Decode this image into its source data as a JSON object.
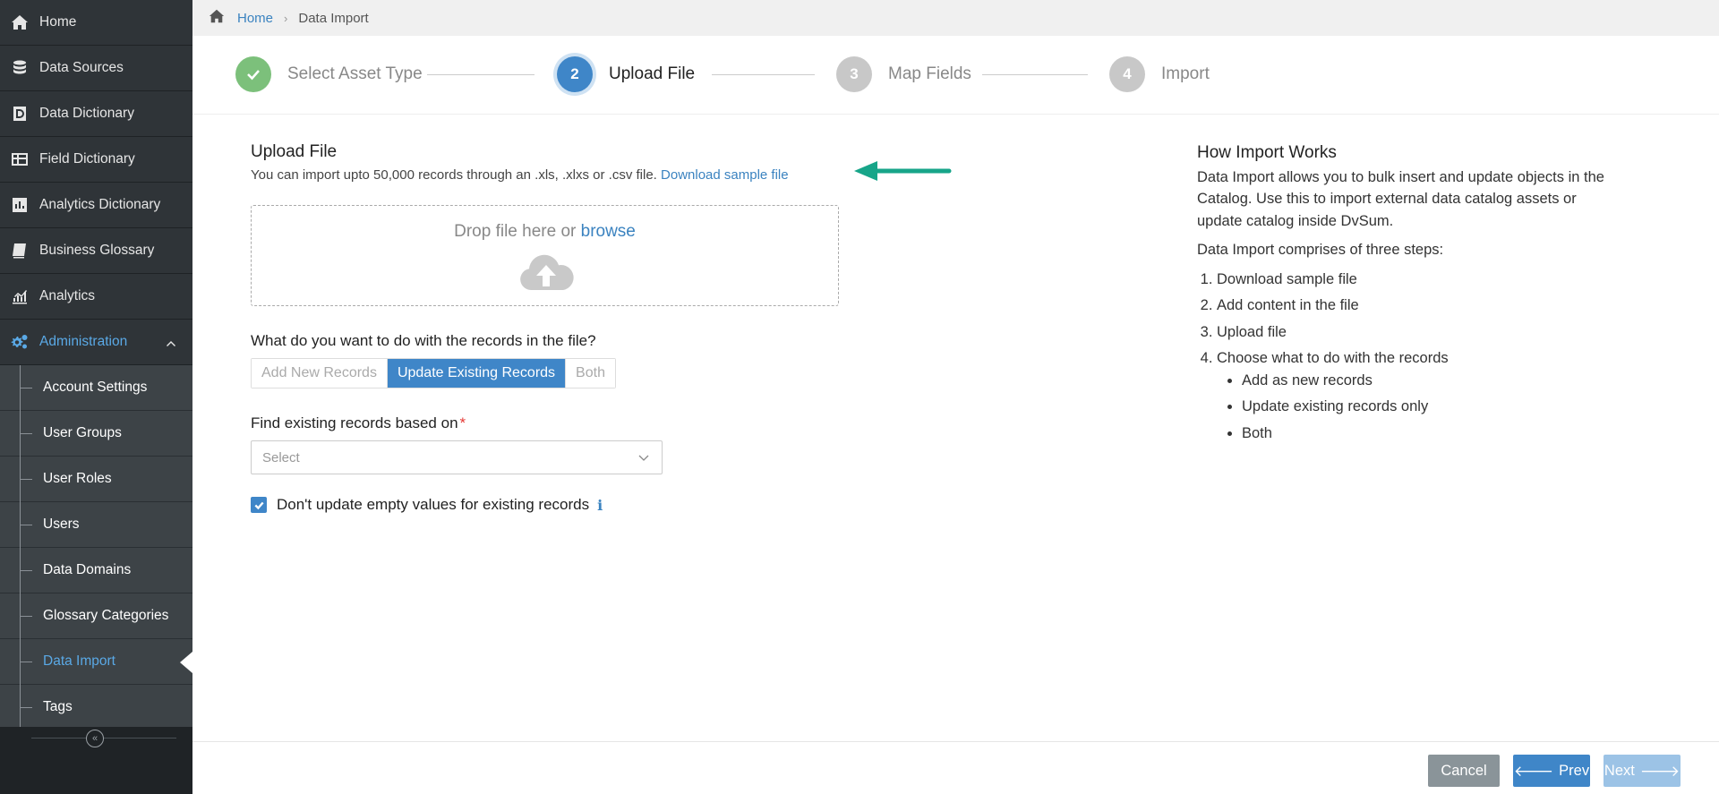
{
  "sidebar": {
    "items": [
      {
        "label": "Home",
        "icon": "home-icon"
      },
      {
        "label": "Data Sources",
        "icon": "database-icon"
      },
      {
        "label": "Data Dictionary",
        "icon": "dictionary-icon"
      },
      {
        "label": "Field Dictionary",
        "icon": "table-icon"
      },
      {
        "label": "Analytics Dictionary",
        "icon": "bar-chart-icon"
      },
      {
        "label": "Business Glossary",
        "icon": "book-icon"
      },
      {
        "label": "Analytics",
        "icon": "analytics-icon"
      },
      {
        "label": "Administration",
        "icon": "gears-icon"
      }
    ],
    "sub_items": [
      {
        "label": "Account Settings"
      },
      {
        "label": "User Groups"
      },
      {
        "label": "User Roles"
      },
      {
        "label": "Users"
      },
      {
        "label": "Data Domains"
      },
      {
        "label": "Glossary Categories"
      },
      {
        "label": "Data Import"
      },
      {
        "label": "Tags"
      }
    ],
    "active_sub_item": "Data Import",
    "accent_color": "#5aa9e6"
  },
  "breadcrumb": {
    "home": "Home",
    "current": "Data Import"
  },
  "stepper": {
    "steps": [
      {
        "number": "",
        "label": "Select Asset Type",
        "state": "done"
      },
      {
        "number": "2",
        "label": "Upload File",
        "state": "current"
      },
      {
        "number": "3",
        "label": "Map Fields",
        "state": "pending"
      },
      {
        "number": "4",
        "label": "Import",
        "state": "pending"
      }
    ]
  },
  "upload": {
    "title": "Upload File",
    "description": "You can import upto 50,000 records through an .xls, .xlxs or .csv file.",
    "sample_link": "Download sample file",
    "drop_text": "Drop file here or",
    "browse": "browse"
  },
  "records": {
    "question": "What do you want to do with the records in the file?",
    "options": [
      "Add New Records",
      "Update Existing Records",
      "Both"
    ],
    "selected": "Update Existing Records"
  },
  "find": {
    "label": "Find existing records based on",
    "required_mark": "*",
    "placeholder": "Select"
  },
  "checkbox": {
    "label": "Don't update empty values for existing records",
    "checked": true
  },
  "help": {
    "title": "How Import Works",
    "intro": "Data Import allows you to bulk insert and update objects in the Catalog. Use this to import external data catalog assets or update catalog inside DvSum.",
    "steps_intro": "Data Import comprises of three steps:",
    "steps": [
      "Download sample file",
      "Add content in the file",
      "Upload file",
      "Choose what to do with the records"
    ],
    "record_options": [
      "Add as new records",
      "Update existing records only",
      "Both"
    ]
  },
  "footer": {
    "cancel": "Cancel",
    "prev": "Prev",
    "next": "Next"
  }
}
